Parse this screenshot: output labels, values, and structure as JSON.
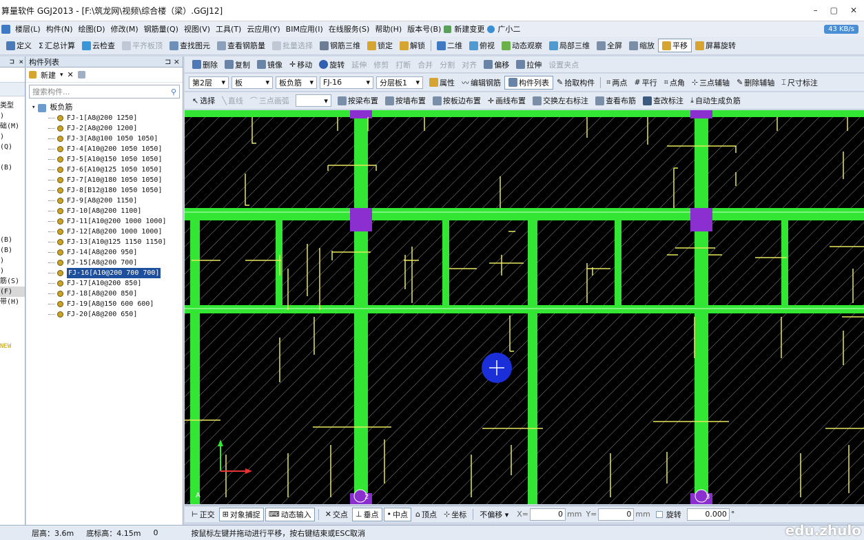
{
  "title": "算量软件 GGJ2013 - [F:\\筑龙网\\视频\\综合楼（梁）.GGJ12]",
  "window": {
    "minimize": "–",
    "maximize": "▢",
    "close": "✕"
  },
  "menu": [
    "楼层(L)",
    "构件(N)",
    "绘图(D)",
    "修改(M)",
    "钢筋量(Q)",
    "视图(V)",
    "工具(T)",
    "云应用(Y)",
    "BIM应用(I)",
    "在线服务(S)",
    "帮助(H)",
    "版本号(B)",
    "新建变更",
    "广小二"
  ],
  "net_speed": "43 KB/s",
  "toolbar1": [
    "定义",
    "汇总计算",
    "云检查",
    "平齐板顶",
    "查找图元",
    "查看钢筋量",
    "批量选择",
    "钢筋三维",
    "锁定",
    "解锁",
    "二维",
    "俯视",
    "动态观察",
    "局部三维",
    "全屏",
    "缩放",
    "平移",
    "屏幕旋转"
  ],
  "panel_titles": {
    "left_pin": "⊐ ×",
    "components": "构件列表",
    "comp_pin": "⊐ ×"
  },
  "comp_toolbar": {
    "new": "新建",
    "delete": "✕"
  },
  "search_placeholder": "搜索构件...",
  "tree_root": "板负筋",
  "tree_items": [
    "FJ-1[A8@200 1250]",
    "FJ-2[A8@200 1200]",
    "FJ-3[A8@100 1050 1050]",
    "FJ-4[A10@200 1050 1050]",
    "FJ-5[A10@150 1050 1050]",
    "FJ-6[A10@125 1050 1050]",
    "FJ-7[A10@180 1050 1050]",
    "FJ-8[B12@180 1050 1050]",
    "FJ-9[A8@200 1150]",
    "FJ-10[A8@200 1100]",
    "FJ-11[A10@200 1000 1000]",
    "FJ-12[A8@200 1000 1000]",
    "FJ-13[A10@125 1150 1150]",
    "FJ-14[A8@200 950]",
    "FJ-15[A8@200 700]",
    "FJ-16[A10@200 700 700]",
    "FJ-17[A10@200 850]",
    "FJ-18[A8@200 850]",
    "FJ-19[A8@150 600 600]",
    "FJ-20[A8@200 650]"
  ],
  "selected_item": "FJ-16[A10@200 700 700]",
  "left_items": [
    "类型",
    ")",
    "础(M)",
    ")",
    "(Q)",
    "",
    "(B)",
    "",
    "",
    "",
    "",
    "",
    "",
    "(B)",
    "(B)",
    ")",
    ")",
    "筋(S)",
    "(F)",
    "带(H)"
  ],
  "left_new": "NEW",
  "edit_toolbar": [
    "删除",
    "复制",
    "镜像",
    "移动",
    "旋转",
    "延伸",
    "修剪",
    "打断",
    "合并",
    "分割",
    "对齐",
    "偏移",
    "拉伸",
    "设置夹点"
  ],
  "layer_toolbar": {
    "floor": "第2层",
    "type": "板",
    "sub": "板负筋",
    "comp": "FJ-16",
    "layer": "分层板1",
    "buttons": [
      "属性",
      "编辑钢筋",
      "构件列表",
      "拾取构件",
      "两点",
      "平行",
      "点角",
      "三点辅轴",
      "删除辅轴",
      "尺寸标注"
    ]
  },
  "draw_toolbar": [
    "选择",
    "直线",
    "三点画弧",
    "按梁布置",
    "按墙布置",
    "按板边布置",
    "画线布置",
    "交换左右标注",
    "查看布筋",
    "查改标注",
    "自动生成负筋"
  ],
  "axis_labels": [
    "A",
    "2",
    "3"
  ],
  "snap_toolbar": [
    "正交",
    "对象捕捉",
    "动态输入",
    "交点",
    "垂点",
    "中点",
    "顶点",
    "坐标",
    "不偏移"
  ],
  "coord": {
    "x_label": "X=",
    "x": "0",
    "y_label": "Y=",
    "y": "0",
    "unit": "mm",
    "rotate_label": "旋转",
    "rotate": "0.000",
    "deg": "°"
  },
  "status": {
    "floor_height": "层高：3.6m",
    "base_height": "底标高：4.15m",
    "zero": "0",
    "hint": "按鼠标左键并拖动进行平移，按右键结束或ESC取消"
  },
  "watermark": "edu.zhulo",
  "colors": {
    "beam": "#33e633",
    "column": "#8b2fd0",
    "rebar": "#e8e85a",
    "canvas": "#000000",
    "cursor": "#1a2fd8",
    "selected": "#1d4f9c"
  }
}
